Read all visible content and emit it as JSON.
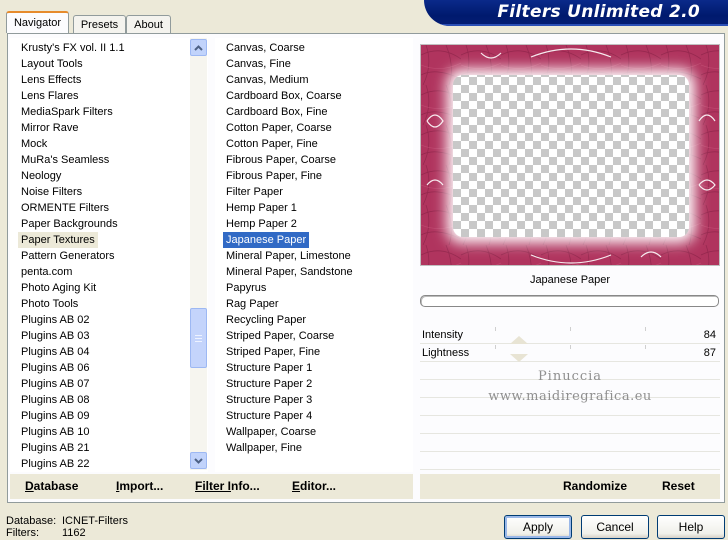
{
  "tabs": [
    "Navigator",
    "Presets",
    "About"
  ],
  "title": "Filters Unlimited 2.0",
  "categories": [
    "Krusty's FX vol. II 1.1",
    "Layout Tools",
    "Lens Effects",
    "Lens Flares",
    "MediaSpark Filters",
    "Mirror Rave",
    "Mock",
    "MuRa's Seamless",
    "Neology",
    "Noise Filters",
    "ORMENTE Filters",
    "Paper Backgrounds",
    "Paper Textures",
    "Pattern Generators",
    "penta.com",
    "Photo Aging Kit",
    "Photo Tools",
    "Plugins AB 02",
    "Plugins AB 03",
    "Plugins AB 04",
    "Plugins AB 06",
    "Plugins AB 07",
    "Plugins AB 08",
    "Plugins AB 09",
    "Plugins AB 10",
    "Plugins AB 21",
    "Plugins AB 22"
  ],
  "selected_category": "Paper Textures",
  "filters": [
    "Canvas, Coarse",
    "Canvas, Fine",
    "Canvas, Medium",
    "Cardboard Box, Coarse",
    "Cardboard Box, Fine",
    "Cotton Paper, Coarse",
    "Cotton Paper, Fine",
    "Fibrous Paper, Coarse",
    "Fibrous Paper, Fine",
    "Filter Paper",
    "Hemp Paper 1",
    "Hemp Paper 2",
    "Japanese Paper",
    "Mineral Paper, Limestone",
    "Mineral Paper, Sandstone",
    "Papyrus",
    "Rag Paper",
    "Recycling Paper",
    "Striped Paper, Coarse",
    "Striped Paper, Fine",
    "Structure Paper 1",
    "Structure Paper 2",
    "Structure Paper 3",
    "Structure Paper 4",
    "Wallpaper, Coarse",
    "Wallpaper, Fine"
  ],
  "selected_filter": "Japanese Paper",
  "preview_label": "Japanese Paper",
  "parameters": [
    {
      "label": "Intensity",
      "value": "84"
    },
    {
      "label": "Lightness",
      "value": "87"
    }
  ],
  "watermark": [
    "Pinuccia",
    "www.maidiregrafica.eu"
  ],
  "list_buttons": [
    {
      "label": "Database",
      "underline": "D",
      "rest": "atabase"
    },
    {
      "label": "Import...",
      "underline": "I",
      "rest": "mport..."
    },
    {
      "label": "Filter Info...",
      "underline": "Filter I",
      "rest": "nfo..."
    },
    {
      "label": "Editor...",
      "underline": "E",
      "rest": "ditor..."
    }
  ],
  "right_buttons": [
    "Randomize",
    "Reset"
  ],
  "footer": {
    "database_label": "Database:",
    "database_value": "ICNET-Filters",
    "filters_label": "Filters:",
    "filters_value": "1162"
  },
  "dialog_buttons": [
    "Apply",
    "Cancel",
    "Help"
  ],
  "colors": {
    "accent": "#316ac5",
    "banner": "#0a2a8a",
    "preview_frame": "#b0345e"
  }
}
